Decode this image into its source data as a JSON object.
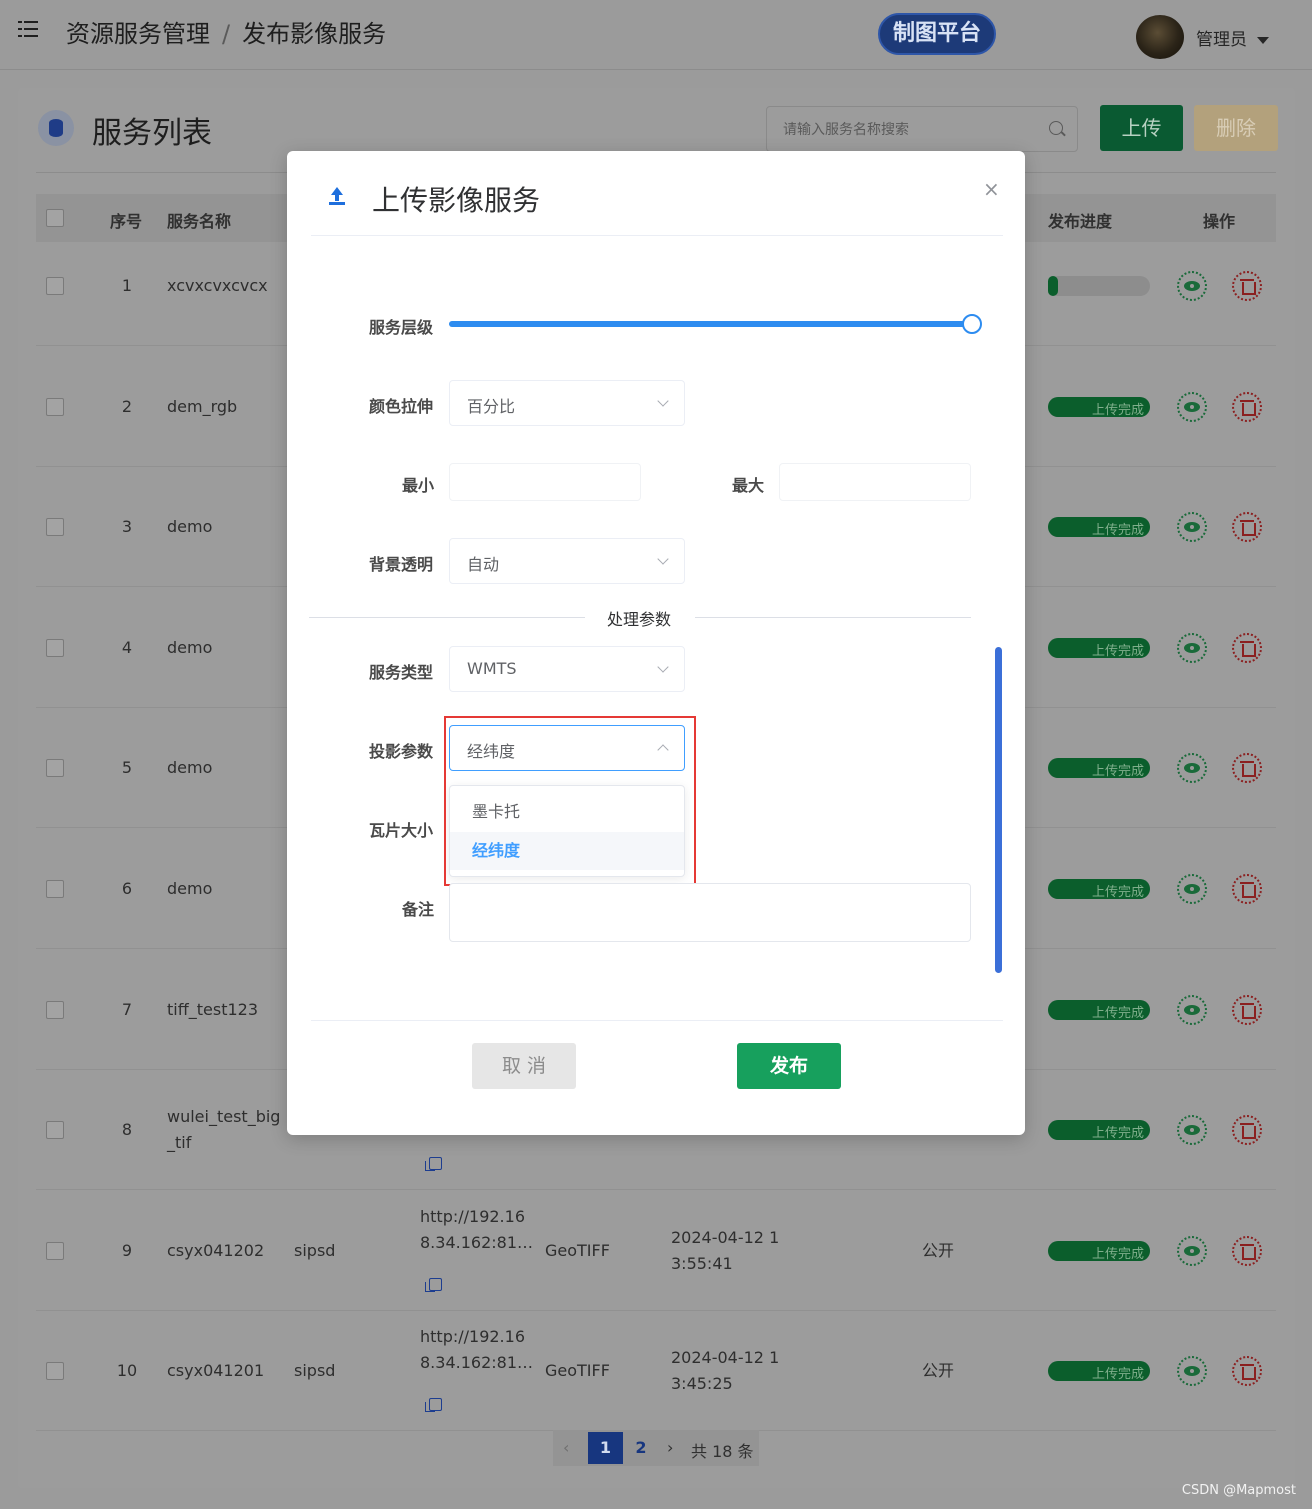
{
  "header": {
    "breadcrumb": [
      "资源服务管理",
      "发布影像服务"
    ],
    "breadcrumb_separator": "/",
    "platform_button": "制图平台",
    "user_name": "管理员"
  },
  "toolbar": {
    "title": "服务列表",
    "search_placeholder": "请输入服务名称搜索",
    "upload_label": "上传",
    "delete_label": "删除"
  },
  "table": {
    "columns": {
      "index": "序号",
      "name": "服务名称",
      "progress": "发布进度",
      "actions": "操作"
    },
    "rows": [
      {
        "index": "1",
        "name": "xcvxcvxcvcx",
        "status": "",
        "progress": 0.1
      },
      {
        "index": "2",
        "name": "dem_rgb",
        "status": "上传完成",
        "progress": 1
      },
      {
        "index": "3",
        "name": "demo",
        "status": "上传完成",
        "progress": 1
      },
      {
        "index": "4",
        "name": "demo",
        "status": "上传完成",
        "progress": 1
      },
      {
        "index": "5",
        "name": "demo",
        "status": "上传完成",
        "progress": 1
      },
      {
        "index": "6",
        "name": "demo",
        "status": "上传完成",
        "progress": 1
      },
      {
        "index": "7",
        "name": "tiff_test123",
        "status": "上传完成",
        "progress": 1
      },
      {
        "index": "8",
        "name": "wulei_test_big\n_tif",
        "status": "上传完成",
        "progress": 1
      },
      {
        "index": "9",
        "name": "csyx041202",
        "owner": "sipsd",
        "url": "http://192.16\n8.34.162:81…",
        "format": "GeoTIFF",
        "time": "2024-04-12 1\n3:55:41",
        "visibility": "公开",
        "status": "上传完成",
        "progress": 1
      },
      {
        "index": "10",
        "name": "csyx041201",
        "owner": "sipsd",
        "url": "http://192.16\n8.34.162:81…",
        "format": "GeoTIFF",
        "time": "2024-04-12 1\n3:45:25",
        "visibility": "公开",
        "status": "上传完成",
        "progress": 1
      }
    ]
  },
  "pagination": {
    "prev": "‹",
    "pages": [
      "1",
      "2"
    ],
    "current": "1",
    "next": "›",
    "total": "共 18 条"
  },
  "modal": {
    "title": "上传影像服务",
    "close": "×",
    "fields": {
      "level_label": "服务层级",
      "level_value_fraction": 1,
      "stretch_label": "颜色拉伸",
      "stretch_value": "百分比",
      "min_label": "最小",
      "min_value": "",
      "max_label": "最大",
      "max_value": "",
      "bg_label": "背景透明",
      "bg_value": "自动",
      "section_title": "处理参数",
      "service_type_label": "服务类型",
      "service_type_value": "WMTS",
      "projection_label": "投影参数",
      "projection_value": "经纬度",
      "projection_options": [
        "墨卡托",
        "经纬度"
      ],
      "tile_label": "瓦片大小",
      "note_label": "备注",
      "note_value": ""
    },
    "cancel_label": "取 消",
    "publish_label": "发布"
  },
  "colors": {
    "primary_blue": "#409eff",
    "slider_blue": "#2d8cf0",
    "publish_green": "#17a05d",
    "highlight_red": "#e53935"
  },
  "icons": {
    "menu": "menu-fold-icon",
    "search": "search-icon",
    "upload": "upload-arrow-icon",
    "view": "eye-icon",
    "delete": "trash-icon",
    "copy": "copy-icon",
    "database": "database-icon"
  },
  "watermark": "CSDN @Mapmost"
}
